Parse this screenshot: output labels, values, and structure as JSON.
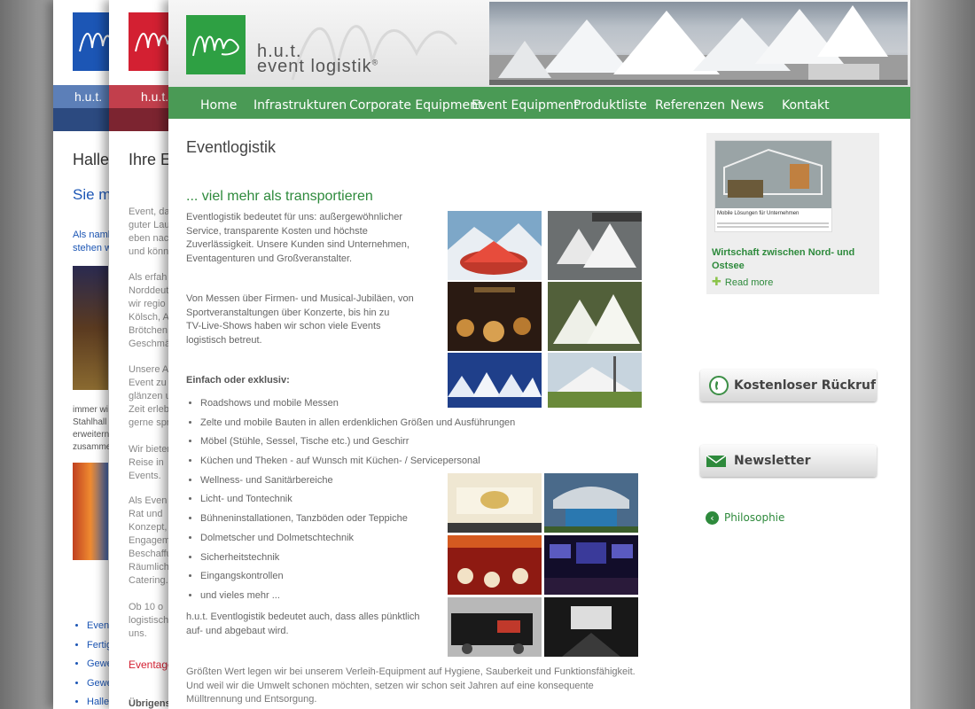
{
  "back_page_1": {
    "brand": "h.u.t.",
    "title": "Hallen",
    "subtitle": "Sie mö",
    "text1": [
      "Als namh",
      "stehen w"
    ],
    "text2": [
      "immer wi",
      "Stahlhall",
      "erweitern",
      "zusamme"
    ],
    "list": [
      "Eventl",
      "Fertig",
      "Gewe",
      "Gewe",
      "Hallen"
    ]
  },
  "back_page_2": {
    "brand": "h.u.t.",
    "title": "Ihre E",
    "p1": [
      "Event, da",
      "guter Lau",
      "eben nac",
      "und könn"
    ],
    "p2": [
      "Als erfah",
      "Norddeut",
      "wir regio",
      "Kölsch, A",
      "Brötchen,",
      "Geschmä"
    ],
    "p3": [
      "Unsere A",
      "Event zu",
      "glänzen u",
      "Zeit erleb",
      "gerne spr"
    ],
    "p4": [
      "Wir bieter",
      "Reise in",
      "Events."
    ],
    "p5": [
      "Als Even",
      "Rat und",
      "Konzept,",
      "Engagem",
      "Beschaffu",
      "Räumlich",
      "Catering."
    ],
    "p6": [
      "Ob 10 o",
      "logistisch",
      "uns."
    ],
    "red_heading": "Eventage",
    "gray_heading": "Übrigens"
  },
  "header": {
    "brand_line1": "h.u.t.",
    "brand_line2": "event logistik",
    "reg": "®"
  },
  "nav": [
    "Home",
    "Infrastrukturen",
    "Corporate Equipment",
    "Event Equipment",
    "Produktliste",
    "Referenzen",
    "News",
    "Kontakt"
  ],
  "main": {
    "title": "Eventlogistik",
    "subtitle": "... viel mehr als transportieren",
    "intro": [
      "Eventlogistik bedeutet für uns: außergewöhnlicher",
      "Service, transparente Kosten und höchste",
      "Zuverlässigkeit. Unsere Kunden sind Unternehmen,",
      "Eventagenturen und Großveranstalter."
    ],
    "intro2": [
      "Von Messen über Firmen- und Musical-Jubiläen, von",
      "Sportveranstaltungen über Konzerte, bis hin zu",
      "TV-Live-Shows haben wir schon viele Events",
      "logistisch betreut."
    ],
    "list_heading": "Einfach oder exklusiv:",
    "list": [
      "Roadshows und mobile Messen",
      "Zelte und mobile Bauten in allen erdenklichen Größen und Ausführungen",
      "Möbel (Stühle, Sessel, Tische etc.) und Geschirr",
      "Küchen und Theken - auf Wunsch mit Küchen- / Servicepersonal",
      "Wellness- und Sanitärbereiche",
      "Licht- und Tontechnik",
      "Bühneninstallationen, Tanzböden oder Teppiche",
      "Dolmetscher und Dolmetschtechnik",
      "Sicherheitstechnik",
      "Eingangskontrollen",
      "und vieles mehr ..."
    ],
    "para3": [
      "h.u.t. Eventlogistik bedeutet auch, dass alles pünktlich",
      "auf- und abgebaut wird."
    ],
    "para4": [
      "Größten Wert legen wir bei unserem Verleih-Equipment auf Hygiene, Sauberkeit und Funktionsfähigkeit.",
      "Und weil wir die Umwelt schonen möchten, setzen wir schon seit Jahren auf eine konsequente",
      "Mülltrennung und Entsorgung."
    ]
  },
  "sidebar": {
    "news_image_caption": "Mobile Lösungen für Unternehmen",
    "news_title": "Wirtschaft zwischen Nord- und Ostsee",
    "read_more": "Read more",
    "callback_button": "Kostenloser Rückruf",
    "newsletter_button": "Newsletter",
    "philosophy_link": "Philosophie"
  },
  "colors": {
    "accent_green": "#2e8a3c",
    "nav_green": "#4a9a55",
    "blue": "#1c56b5",
    "red": "#d32032"
  }
}
